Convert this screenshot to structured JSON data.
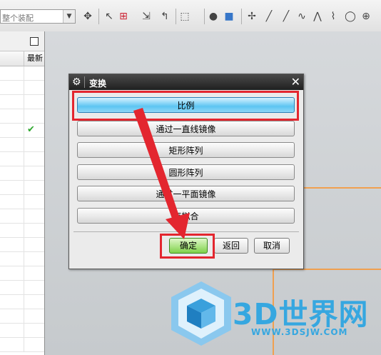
{
  "toolbar": {
    "filter_value": "整个装配",
    "icons": [
      "sketch-icon",
      "snap-icon",
      "select-icon",
      "move-icon",
      "box-select-icon",
      "sphere-icon",
      "cube-icon",
      "point-icon",
      "line-icon",
      "line-icon",
      "spline-icon",
      "curve-icon",
      "polyline-icon",
      "circle-icon",
      "point-icon",
      "target-icon"
    ]
  },
  "left_panel": {
    "column_header": "最新",
    "checked_row_index": 4
  },
  "dialog": {
    "title": "变换",
    "options": [
      "比例",
      "通过一直线镜像",
      "矩形阵列",
      "圆形阵列",
      "通过一平面镜像",
      "点拟合"
    ],
    "selected_option": "比例",
    "ok_label": "确定",
    "back_label": "返回",
    "cancel_label": "取消"
  },
  "annotation": {
    "highlight_color": "#e3262f"
  },
  "watermark": {
    "title": "3D世界网",
    "url": "WWW.3DSJW.COM",
    "color": "#36a7e0"
  }
}
